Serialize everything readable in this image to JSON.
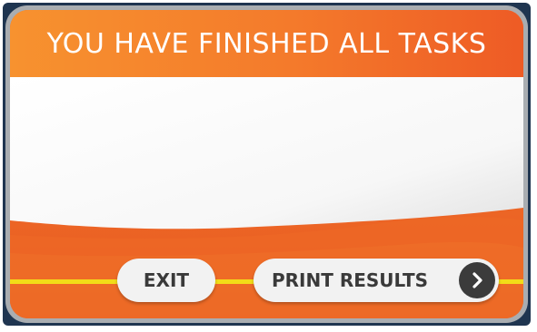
{
  "dialog": {
    "title": "YOU HAVE FINISHED ALL TASKS"
  },
  "buttons": {
    "exit_label": "EXIT",
    "print_label": "PRINT RESULTS",
    "print_icon": "chevron-right-icon"
  },
  "colors": {
    "orange_primary": "#ef6226",
    "orange_light": "#f6822e",
    "frame_gray": "#a9adb1",
    "frame_border": "#1f3550",
    "connector_yellow": "#f2dc18",
    "button_bg": "#f2f2f2",
    "button_text": "#3a3a3a",
    "arrow_bg": "#3b3b3b"
  }
}
